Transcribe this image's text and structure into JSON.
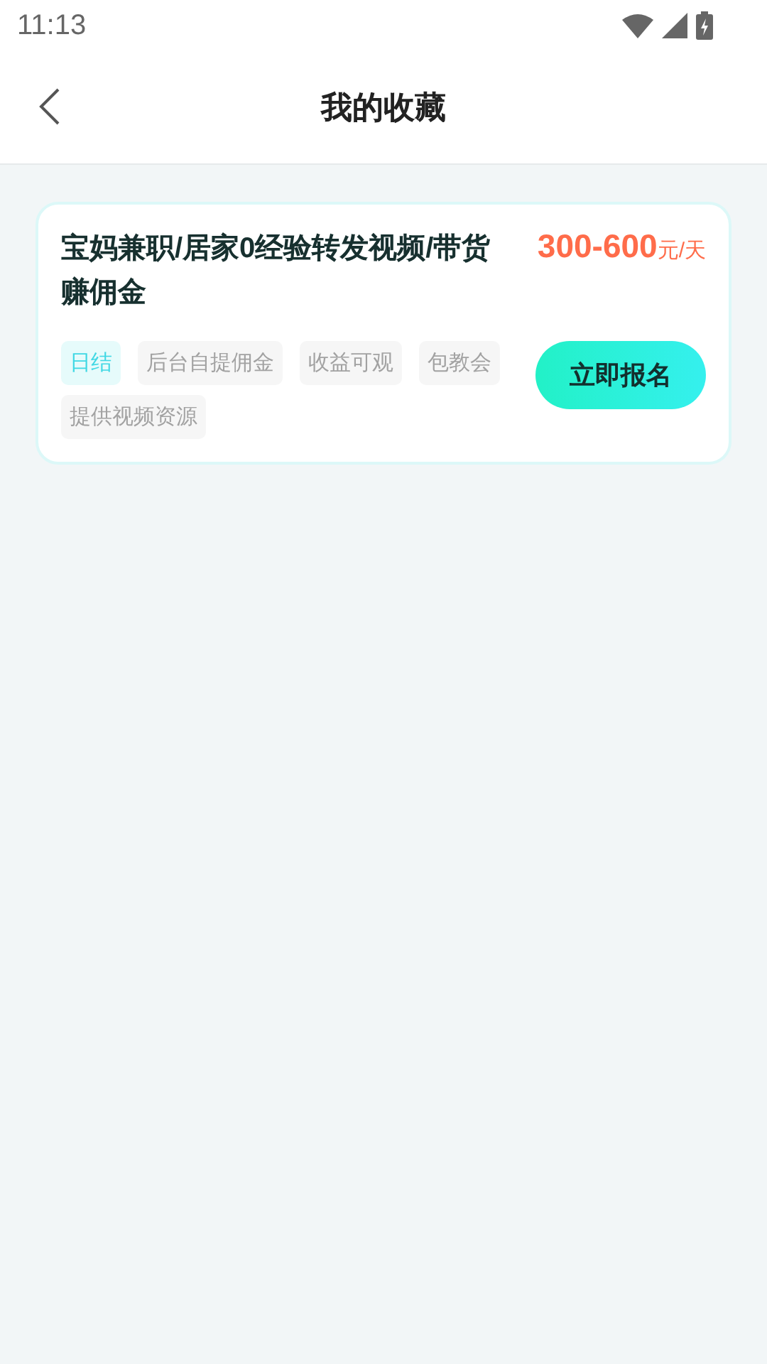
{
  "status_bar": {
    "time": "11:13"
  },
  "header": {
    "title": "我的收藏"
  },
  "favorites": [
    {
      "title": "宝妈兼职/居家0经验转发视频/带货赚佣金",
      "salary": "300-600",
      "unit": "元/天",
      "button": "立即报名",
      "tags": [
        {
          "label": "日结",
          "kind": "highlight"
        },
        {
          "label": "后台自提佣金",
          "kind": "plain"
        },
        {
          "label": "收益可观",
          "kind": "plain"
        },
        {
          "label": "包教会",
          "kind": "plain"
        },
        {
          "label": "提供视频资源",
          "kind": "plain"
        }
      ]
    }
  ]
}
